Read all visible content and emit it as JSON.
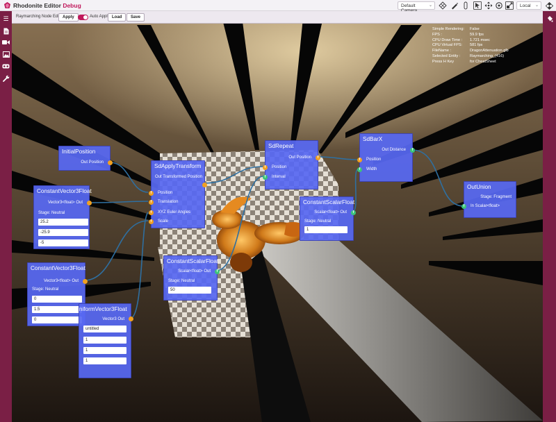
{
  "app": {
    "title": "Rhodonite Editor",
    "mode": "Debug",
    "camera": "Default Camera",
    "space": "Local"
  },
  "editor": {
    "title": "Raymarching Node Editor",
    "apply_label": "Apply",
    "auto_apply_label": "Auto Apply",
    "auto_apply_on": true,
    "load_label": "Load",
    "save_label": "Save"
  },
  "stats": [
    {
      "key": "Simple Rendering:",
      "value": "False"
    },
    {
      "key": "FPS :",
      "value": "59.9 fps"
    },
    {
      "key": "CPU Draw Time :",
      "value": "1.721 msec"
    },
    {
      "key": "CPU Virtual FPS:",
      "value": "581 fps"
    },
    {
      "key": "FileName :",
      "value": "DragonAttenuation.glb"
    },
    {
      "key": "Selected Entity :",
      "value": "Raymarching_(416)"
    },
    {
      "key": "Press H Key",
      "value": "for CheatSheet"
    }
  ],
  "nodes": {
    "initial_position": {
      "title": "InitialPosition",
      "out": "Out Position"
    },
    "const_vec3_a": {
      "title": "ConstantVector3Float",
      "out": "Vector3<float> Out",
      "stage": "Stage: Neutral",
      "values": [
        "25.2",
        "-25.9",
        "-5"
      ]
    },
    "const_vec3_b": {
      "title": "ConstantVector3Float",
      "out": "Vector3<float> Out",
      "stage": "Stage: Neutral",
      "values": [
        "0",
        "1.5",
        "0"
      ]
    },
    "uniform_vec3": {
      "title": "UniformVector3Float",
      "out": "Vector3 Out",
      "values": [
        "untitled",
        "1",
        "1",
        "1"
      ]
    },
    "sd_apply_transform": {
      "title": "SdApplyTransform",
      "out": "Out Transformed Position",
      "inputs": [
        "Position",
        "Translation",
        "XYZ Euler Angles",
        "Scale"
      ]
    },
    "sd_repeat": {
      "title": "SdRepeat",
      "out": "Out Position",
      "inputs": [
        "Position",
        "Interval"
      ]
    },
    "const_scalar_a": {
      "title": "ConstantScalarFloat",
      "out": "Scalar<float> Out",
      "stage": "Stage: Neutral",
      "value": "1"
    },
    "const_scalar_b": {
      "title": "ConstantScalarFloat",
      "out": "Scalar<float> Out",
      "stage": "Stage: Neutral",
      "value": "50"
    },
    "sd_bar_x": {
      "title": "SdBarX",
      "out": "Out Distance",
      "inputs": [
        "Position",
        "Width"
      ]
    },
    "out_union": {
      "title": "OutUnion",
      "stage": "Stage: Fragment",
      "input": "In Scalar<float>"
    }
  },
  "icons": {
    "sidebar": [
      "list-icon",
      "document-icon",
      "video-camera-icon",
      "image-icon",
      "vr-goggles-icon",
      "wrench-icon"
    ],
    "toolbar": [
      "diamond-grid-icon",
      "pen-icon",
      "capsule-icon",
      "select-icon",
      "move-icon",
      "rotate-icon",
      "scale-icon",
      "expand-icon",
      "checker-icon"
    ]
  },
  "colors": {
    "accent": "#c0185b",
    "sidebar": "#7a1f45",
    "node": "#5768f2",
    "socket_float": "#f0a021",
    "socket_value": "#3bc47a",
    "wire": "#2f6fa0"
  }
}
